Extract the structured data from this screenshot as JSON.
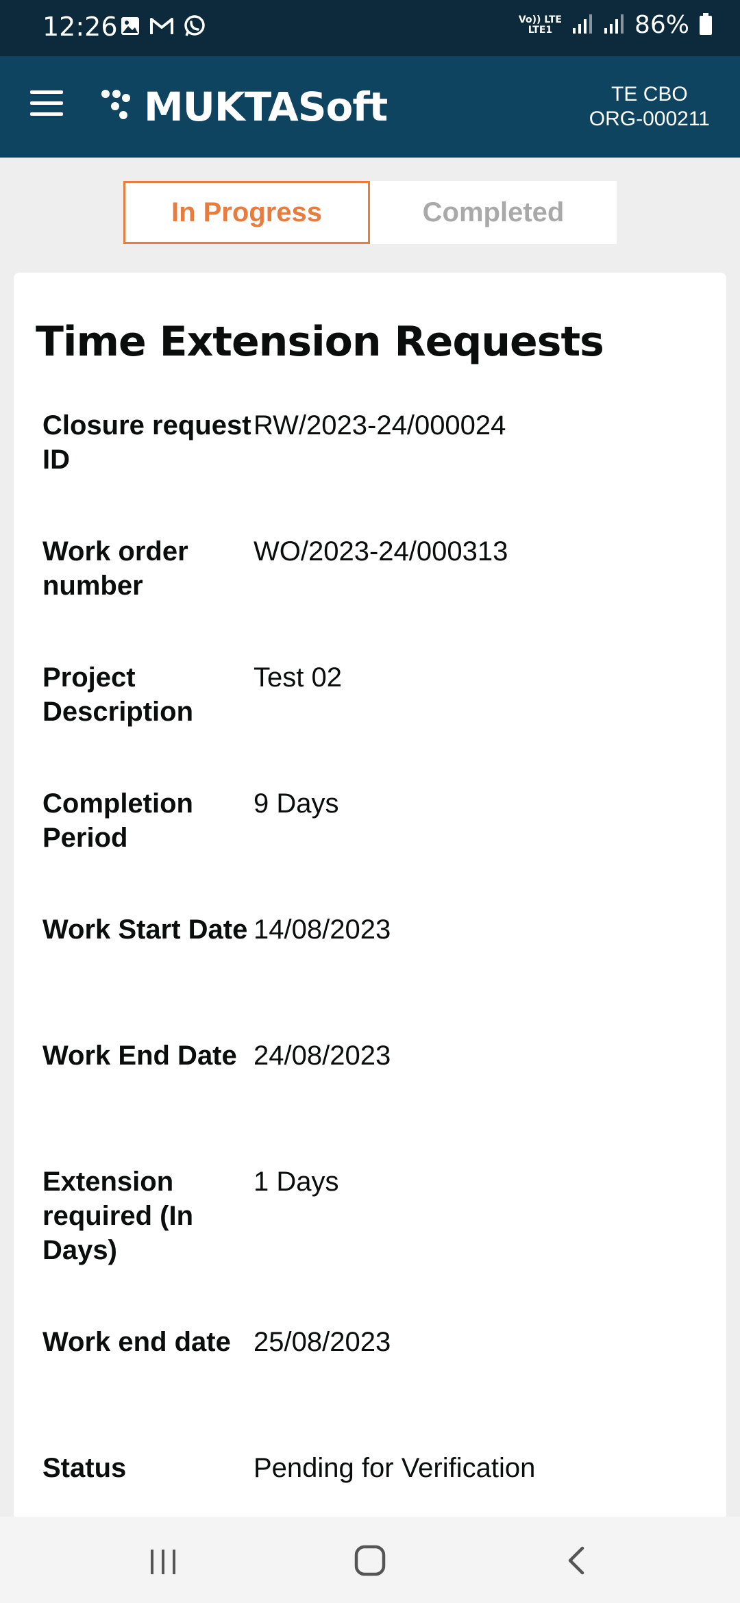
{
  "status_bar": {
    "time": "12:26",
    "network_top": "Vo)) LTE",
    "network_bottom": "LTE1",
    "battery": "86%"
  },
  "app_bar": {
    "brand": "MUKTASoft",
    "org_name": "TE CBO",
    "org_id": "ORG-000211"
  },
  "tabs": [
    {
      "label": "In Progress",
      "active": true
    },
    {
      "label": "Completed",
      "active": false
    }
  ],
  "card": {
    "title": "Time Extension Requests",
    "rows": [
      {
        "label": "Closure request ID",
        "value": "RW/2023-24/000024"
      },
      {
        "label": "Work order number",
        "value": "WO/2023-24/000313"
      },
      {
        "label": "Project Description",
        "value": "Test 02"
      },
      {
        "label": "Completion Period",
        "value": "9 Days"
      },
      {
        "label": "Work Start Date",
        "value": "14/08/2023"
      },
      {
        "label": "Work End Date",
        "value": "24/08/2023"
      },
      {
        "label": "Extension required (In Days)",
        "value": "1 Days"
      },
      {
        "label": "Work end date",
        "value": "25/08/2023"
      },
      {
        "label": "Status",
        "value": "Pending for Verification"
      }
    ]
  },
  "colors": {
    "status_bar": "#0c2a3c",
    "app_bar": "#0e4460",
    "accent": "#e87c3e",
    "inactive_tab": "#a9a9a9"
  },
  "icons": {
    "menu": "hamburger-icon",
    "gallery": "image-icon",
    "mail": "gmail-icon",
    "chat": "whatsapp-icon",
    "signal": "signal-icon",
    "battery": "battery-icon",
    "nav_recent": "recent-apps-icon",
    "nav_home": "home-icon",
    "nav_back": "back-icon"
  }
}
